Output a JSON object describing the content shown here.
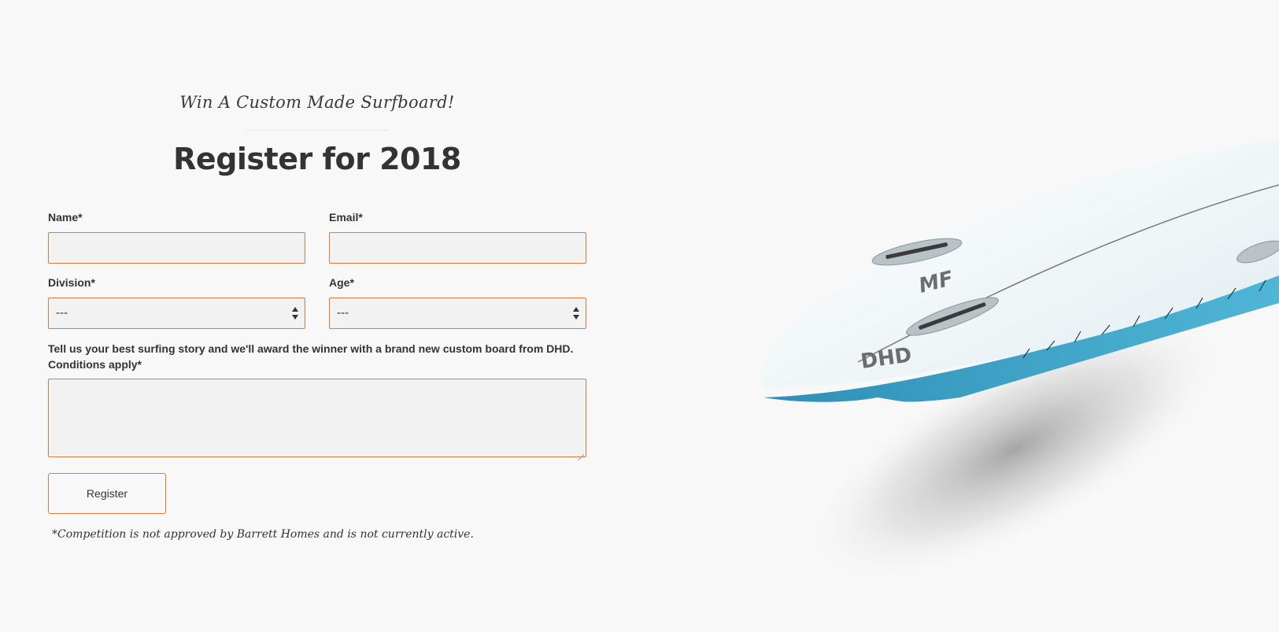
{
  "hero": {
    "tagline": "Win A Custom Made Surfboard!",
    "title": "Register for 2018"
  },
  "form": {
    "name_label": "Name*",
    "email_label": "Email*",
    "division_label": "Division*",
    "division_value": "---",
    "age_label": "Age*",
    "age_value": "---",
    "story_label_line1": "Tell us your best surfing story and we'll award the winner with a brand new custom board from DHD.",
    "story_label_line2": "Conditions apply*",
    "submit_label": "Register",
    "disclaimer": "*Competition is not approved by Barrett Homes and is not currently active."
  },
  "image": {
    "subject": "surfboard",
    "logo_top": "MF",
    "logo_bottom": "DHD"
  },
  "colors": {
    "background": "#f8f8f8",
    "field_border": "#e07a3e",
    "field_fill": "#f2f2f2",
    "text": "#333333",
    "board_rail": "#3b9fc4"
  }
}
